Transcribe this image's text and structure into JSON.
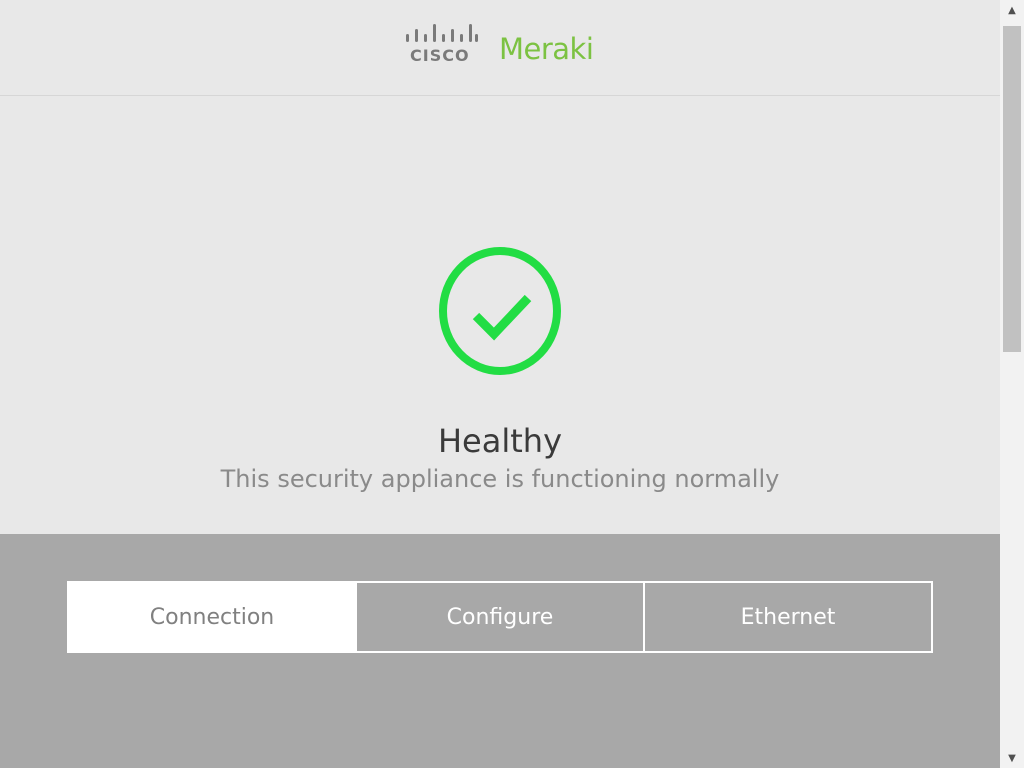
{
  "header": {
    "logo": {
      "cisco_text": "CISCO",
      "meraki_text": "Meraki",
      "icon": "cisco-bridge-icon",
      "meraki_color": "#7cc242"
    }
  },
  "status": {
    "icon": "check-circle-icon",
    "icon_color": "#22dd44",
    "title": "Healthy",
    "subtitle": "This security appliance is functioning normally"
  },
  "tabs": [
    {
      "label": "Connection",
      "active": true
    },
    {
      "label": "Configure",
      "active": false
    },
    {
      "label": "Ethernet",
      "active": false
    }
  ],
  "scrollbar": {
    "up_icon": "triangle-up-icon",
    "down_icon": "triangle-down-icon"
  }
}
